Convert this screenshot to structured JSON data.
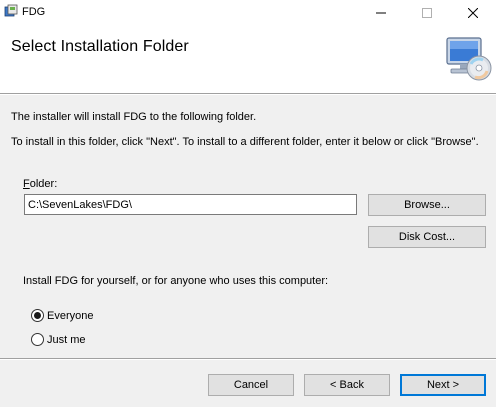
{
  "window": {
    "title": "FDG",
    "minimize_icon": "minimize-icon",
    "maximize_icon": "maximize-icon",
    "close_icon": "close-icon"
  },
  "banner": {
    "title": "Select Installation Folder",
    "graphic_icon": "computer-cd-icon"
  },
  "body": {
    "info_line1": "The installer will install FDG to the following folder.",
    "info_line2": "To install in this folder, click \"Next\". To install to a different folder, enter it below or click \"Browse\".",
    "folder_label_accel": "F",
    "folder_label_rest": "older:",
    "folder_value": "C:\\SevenLakes\\FDG\\",
    "browse_label": "Browse...",
    "disk_cost_label": "Disk Cost...",
    "scope_text": "Install FDG for yourself, or for anyone who uses this computer:",
    "radio_everyone": "Everyone",
    "radio_justme": "Just me",
    "selected_scope": "Everyone"
  },
  "footer": {
    "cancel_label": "Cancel",
    "back_label": "< Back",
    "next_label": "Next >"
  }
}
